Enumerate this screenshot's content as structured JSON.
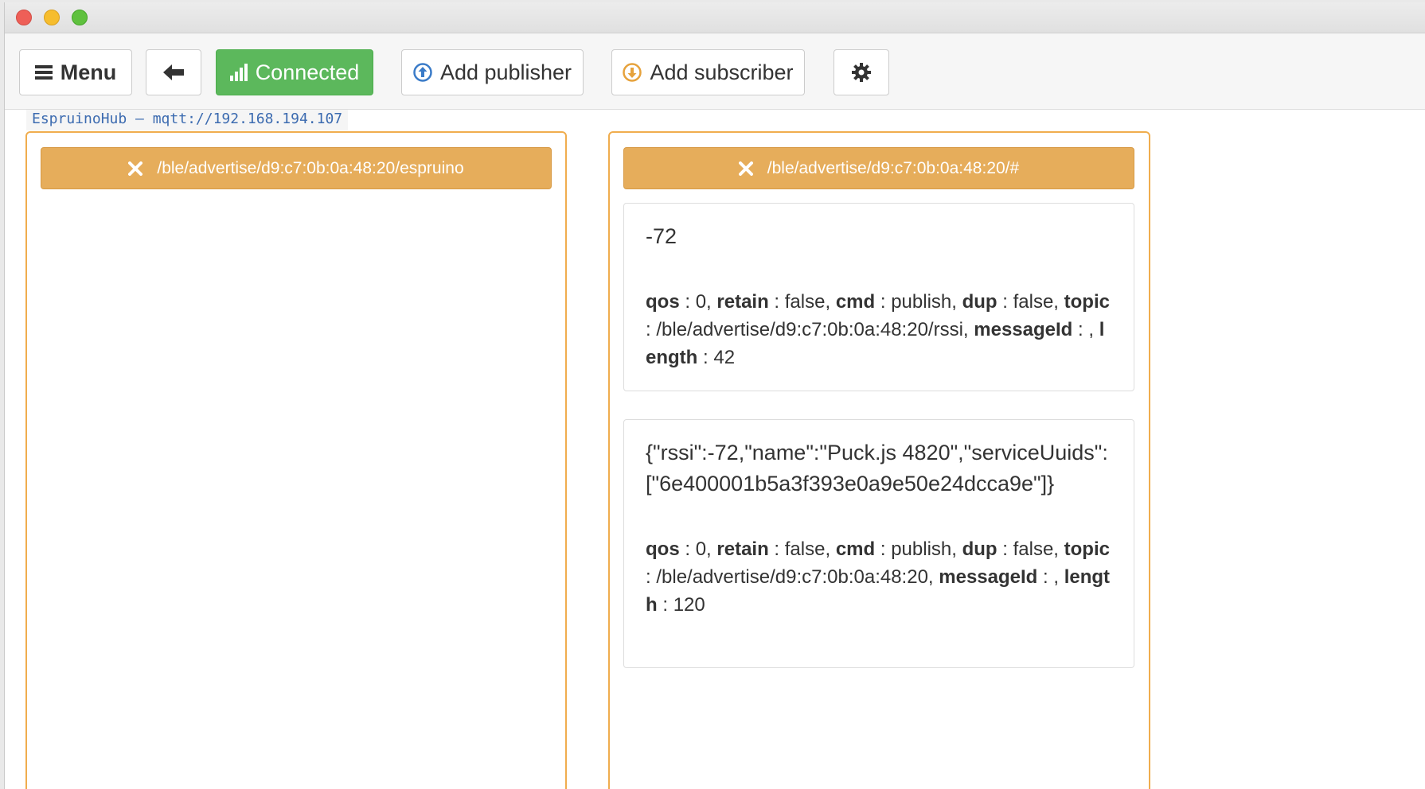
{
  "toolbar": {
    "menu_label": "Menu",
    "connected_label": "Connected",
    "add_publisher_label": "Add publisher",
    "add_subscriber_label": "Add subscriber"
  },
  "status_text": "EspruinoHub – mqtt://192.168.194.107",
  "publisher_panel": {
    "topic": "/ble/advertise/d9:c7:0b:0a:48:20/espruino"
  },
  "subscriber_panel": {
    "topic": "/ble/advertise/d9:c7:0b:0a:48:20/#",
    "messages": [
      {
        "payload": "-72",
        "qos": "0",
        "retain": "false",
        "cmd": "publish",
        "dup": "false",
        "topic": "/ble/advertise/d9:c7:0b:0a:48:20/rssi",
        "messageId": "",
        "length": "42"
      },
      {
        "payload": "{\"rssi\":-72,\"name\":\"Puck.js 4820\",\"serviceUuids\":[\"6e400001b5a3f393e0a9e50e24dcca9e\"]}",
        "qos": "0",
        "retain": "false",
        "cmd": "publish",
        "dup": "false",
        "topic": "/ble/advertise/d9:c7:0b:0a:48:20",
        "messageId": "",
        "length": "120"
      }
    ]
  },
  "icons": {
    "menu": "hamburger-icon",
    "back": "arrow-left-icon",
    "connected": "signal-bars-icon",
    "publisher": "circle-arrow-up-icon",
    "subscriber": "circle-arrow-down-icon",
    "settings": "gear-icon",
    "remove": "close-icon"
  },
  "colors": {
    "connected_bg": "#5cb85c",
    "topic_bg": "#e6ad5b",
    "panel_border": "#f0ad4e",
    "publisher_icon": "#3a7bc8",
    "subscriber_icon": "#e6a23c"
  },
  "meta_keys": {
    "qos": "qos",
    "retain": "retain",
    "cmd": "cmd",
    "dup": "dup",
    "topic": "topic",
    "messageId": "messageId",
    "length": "length"
  }
}
